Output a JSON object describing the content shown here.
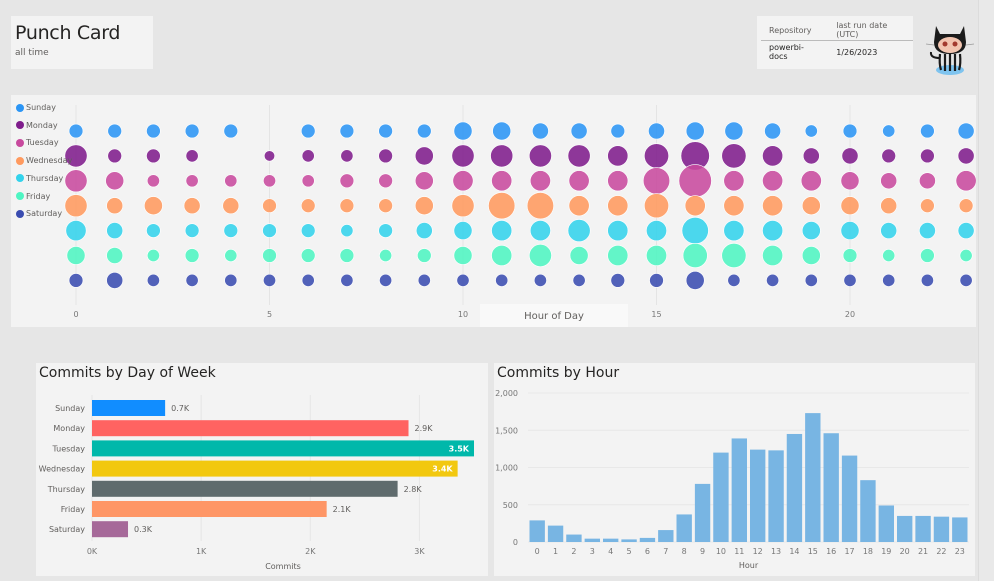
{
  "header": {
    "title": "Punch Card",
    "subtitle": "all time"
  },
  "repo_table": {
    "columns": [
      "Repository",
      "last run date (UTC)"
    ],
    "rows": [
      [
        "powerbi-docs",
        "1/26/2023"
      ]
    ]
  },
  "logo": "octocat-icon",
  "chart_data": [
    {
      "type": "scatter",
      "title": "Punch Card",
      "xlabel": "Hour of Day",
      "ylabel": "",
      "x_ticks": [
        0,
        5,
        10,
        15,
        20
      ],
      "xlim": [
        0,
        23
      ],
      "legend": "left",
      "series": [
        {
          "name": "Sunday",
          "color": "#2b95f5",
          "values": [
            70,
            70,
            70,
            70,
            70,
            null,
            70,
            70,
            70,
            70,
            120,
            120,
            95,
            95,
            70,
            95,
            120,
            120,
            95,
            55,
            70,
            55,
            70,
            95
          ]
        },
        {
          "name": "Monday",
          "color": "#7f1d8c",
          "values": [
            180,
            70,
            70,
            55,
            null,
            40,
            55,
            55,
            70,
            120,
            180,
            180,
            180,
            180,
            150,
            215,
            295,
            215,
            150,
            95,
            95,
            70,
            70,
            95
          ]
        },
        {
          "name": "Tuesday",
          "color": "#c84a9e",
          "values": [
            180,
            120,
            55,
            55,
            55,
            55,
            55,
            70,
            70,
            120,
            150,
            150,
            150,
            150,
            150,
            255,
            385,
            150,
            150,
            150,
            120,
            95,
            95,
            150
          ]
        },
        {
          "name": "Wednesday",
          "color": "#ff9a5f",
          "values": [
            180,
            95,
            120,
            95,
            95,
            70,
            70,
            70,
            70,
            120,
            180,
            255,
            255,
            150,
            150,
            215,
            150,
            150,
            150,
            120,
            120,
            95,
            70,
            70
          ]
        },
        {
          "name": "Thursday",
          "color": "#33d3ec",
          "values": [
            150,
            95,
            70,
            70,
            70,
            70,
            70,
            55,
            70,
            95,
            120,
            150,
            150,
            180,
            150,
            150,
            255,
            150,
            150,
            120,
            120,
            95,
            95,
            95
          ]
        },
        {
          "name": "Friday",
          "color": "#4ef5c2",
          "values": [
            120,
            95,
            55,
            70,
            55,
            70,
            70,
            70,
            55,
            70,
            120,
            150,
            180,
            120,
            150,
            150,
            215,
            215,
            150,
            120,
            70,
            55,
            70,
            55
          ]
        },
        {
          "name": "Saturday",
          "color": "#3a4cb0",
          "values": [
            70,
            95,
            55,
            55,
            55,
            55,
            55,
            55,
            55,
            55,
            55,
            55,
            55,
            55,
            70,
            70,
            120,
            55,
            55,
            55,
            55,
            55,
            55,
            55
          ]
        }
      ]
    },
    {
      "type": "bar",
      "orientation": "horizontal",
      "title": "Commits by Day of Week",
      "xlabel": "Commits",
      "ylabel": "",
      "categories": [
        "Sunday",
        "Monday",
        "Tuesday",
        "Wednesday",
        "Thursday",
        "Friday",
        "Saturday"
      ],
      "values": [
        670,
        2900,
        3500,
        3350,
        2800,
        2150,
        330
      ],
      "data_labels": [
        "0.7K",
        "2.9K",
        "3.5K",
        "3.4K",
        "2.8K",
        "2.1K",
        "0.3K"
      ],
      "colors": [
        "#118dff",
        "#ff6361",
        "#00b8aa",
        "#f2c80f",
        "#5f6b6d",
        "#fe9666",
        "#a66999"
      ],
      "x_ticks": [
        "0K",
        "1K",
        "2K",
        "3K"
      ],
      "xlim": [
        0,
        3500
      ],
      "grid": true
    },
    {
      "type": "bar",
      "title": "Commits by Hour",
      "xlabel": "Hour",
      "ylabel": "",
      "categories": [
        "0",
        "1",
        "2",
        "3",
        "4",
        "5",
        "6",
        "7",
        "8",
        "9",
        "10",
        "11",
        "12",
        "13",
        "14",
        "15",
        "16",
        "17",
        "18",
        "19",
        "20",
        "21",
        "22",
        "23"
      ],
      "values": [
        290,
        220,
        100,
        45,
        45,
        35,
        55,
        160,
        370,
        780,
        1200,
        1390,
        1240,
        1230,
        1450,
        1730,
        1460,
        1160,
        830,
        490,
        350,
        350,
        340,
        330
      ],
      "color": "#78b5e3",
      "y_ticks": [
        "0",
        "500",
        "1,000",
        "1,500",
        "2,000"
      ],
      "ylim": [
        0,
        2000
      ],
      "grid": true
    }
  ]
}
